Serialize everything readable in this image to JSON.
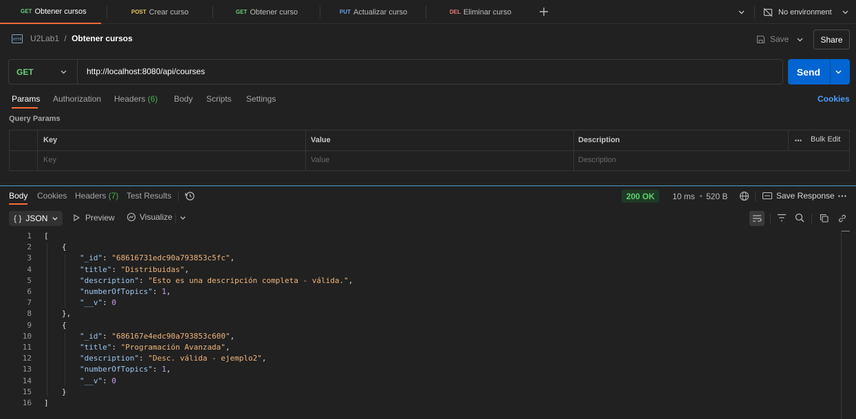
{
  "tabs": [
    {
      "method": "GET",
      "method_color": "#6ccf7a",
      "label": "Obtener cursos",
      "active": true,
      "dirty": false
    },
    {
      "method": "POST",
      "method_color": "#e8c55a",
      "label": "Crear curso",
      "active": false,
      "dirty": true
    },
    {
      "method": "GET",
      "method_color": "#6ccf7a",
      "label": "Obtener curso",
      "active": false,
      "dirty": false
    },
    {
      "method": "PUT",
      "method_color": "#6aa2f0",
      "label": "Actualizar curso",
      "active": false,
      "dirty": false
    },
    {
      "method": "DEL",
      "method_color": "#f07878",
      "label": "Eliminar curso",
      "active": false,
      "dirty": true
    }
  ],
  "environment": {
    "label": "No environment"
  },
  "header": {
    "breadcrumb_parent": "U2Lab1",
    "breadcrumb_sep": "/",
    "request_name": "Obtener cursos",
    "save_label": "Save",
    "share_label": "Share",
    "http_icon_text": "HTTP"
  },
  "request": {
    "method": "GET",
    "url": "http://localhost:8080/api/courses",
    "send_label": "Send"
  },
  "request_tabs": {
    "params": "Params",
    "authorization": "Authorization",
    "headers": "Headers",
    "headers_count": "(6)",
    "body": "Body",
    "scripts": "Scripts",
    "settings": "Settings",
    "cookies": "Cookies"
  },
  "query_params": {
    "title": "Query Params",
    "col_key": "Key",
    "col_value": "Value",
    "col_description": "Description",
    "bulk_edit": "Bulk Edit",
    "ph_key": "Key",
    "ph_value": "Value",
    "ph_description": "Description"
  },
  "response_tabs": {
    "body": "Body",
    "cookies": "Cookies",
    "headers": "Headers",
    "headers_count": "(7)",
    "test_results": "Test Results"
  },
  "response_meta": {
    "status": "200 OK",
    "time": "10 ms",
    "size": "520 B",
    "save_response": "Save Response"
  },
  "body_toolbar": {
    "format": "JSON",
    "format_prefix": "{ }",
    "preview": "Preview",
    "visualize": "Visualize"
  },
  "response_body": {
    "lines": [
      {
        "n": "1",
        "indent": 0,
        "parts": [
          {
            "t": "[",
            "c": "p"
          }
        ]
      },
      {
        "n": "2",
        "indent": 1,
        "parts": [
          {
            "t": "{",
            "c": "p"
          }
        ]
      },
      {
        "n": "3",
        "indent": 2,
        "parts": [
          {
            "t": "\"_id\"",
            "c": "k"
          },
          {
            "t": ": ",
            "c": "p"
          },
          {
            "t": "\"68616731edc90a793853c5fc\"",
            "c": "s"
          },
          {
            "t": ",",
            "c": "p"
          }
        ]
      },
      {
        "n": "4",
        "indent": 2,
        "parts": [
          {
            "t": "\"title\"",
            "c": "k"
          },
          {
            "t": ": ",
            "c": "p"
          },
          {
            "t": "\"Distribuidas\"",
            "c": "s"
          },
          {
            "t": ",",
            "c": "p"
          }
        ]
      },
      {
        "n": "5",
        "indent": 2,
        "parts": [
          {
            "t": "\"description\"",
            "c": "k"
          },
          {
            "t": ": ",
            "c": "p"
          },
          {
            "t": "\"Esto es una descripción completa - válida.\"",
            "c": "s"
          },
          {
            "t": ",",
            "c": "p"
          }
        ]
      },
      {
        "n": "6",
        "indent": 2,
        "parts": [
          {
            "t": "\"numberOfTopics\"",
            "c": "k"
          },
          {
            "t": ": ",
            "c": "p"
          },
          {
            "t": "1",
            "c": "n"
          },
          {
            "t": ",",
            "c": "p"
          }
        ]
      },
      {
        "n": "7",
        "indent": 2,
        "parts": [
          {
            "t": "\"__v\"",
            "c": "k"
          },
          {
            "t": ": ",
            "c": "p"
          },
          {
            "t": "0",
            "c": "n"
          }
        ]
      },
      {
        "n": "8",
        "indent": 1,
        "parts": [
          {
            "t": "},",
            "c": "p"
          }
        ]
      },
      {
        "n": "9",
        "indent": 1,
        "parts": [
          {
            "t": "{",
            "c": "p"
          }
        ]
      },
      {
        "n": "10",
        "indent": 2,
        "parts": [
          {
            "t": "\"_id\"",
            "c": "k"
          },
          {
            "t": ": ",
            "c": "p"
          },
          {
            "t": "\"686167e4edc90a793853c600\"",
            "c": "s"
          },
          {
            "t": ",",
            "c": "p"
          }
        ]
      },
      {
        "n": "11",
        "indent": 2,
        "parts": [
          {
            "t": "\"title\"",
            "c": "k"
          },
          {
            "t": ": ",
            "c": "p"
          },
          {
            "t": "\"Programación Avanzada\"",
            "c": "s"
          },
          {
            "t": ",",
            "c": "p"
          }
        ]
      },
      {
        "n": "12",
        "indent": 2,
        "parts": [
          {
            "t": "\"description\"",
            "c": "k"
          },
          {
            "t": ": ",
            "c": "p"
          },
          {
            "t": "\"Desc. válida - ejemplo2\"",
            "c": "s"
          },
          {
            "t": ",",
            "c": "p"
          }
        ]
      },
      {
        "n": "13",
        "indent": 2,
        "parts": [
          {
            "t": "\"numberOfTopics\"",
            "c": "k"
          },
          {
            "t": ": ",
            "c": "p"
          },
          {
            "t": "1",
            "c": "n"
          },
          {
            "t": ",",
            "c": "p"
          }
        ]
      },
      {
        "n": "14",
        "indent": 2,
        "parts": [
          {
            "t": "\"__v\"",
            "c": "k"
          },
          {
            "t": ": ",
            "c": "p"
          },
          {
            "t": "0",
            "c": "n"
          }
        ]
      },
      {
        "n": "15",
        "indent": 1,
        "parts": [
          {
            "t": "}",
            "c": "p"
          }
        ]
      },
      {
        "n": "16",
        "indent": 0,
        "parts": [
          {
            "t": "]",
            "c": "p"
          }
        ]
      }
    ]
  },
  "colors": {
    "accent": "#ff6c37",
    "send": "#0265d2",
    "status_ok": "#4caf50",
    "link": "#4a9eff"
  },
  "icons": [
    "http-icon",
    "save-icon",
    "chevron-down-icon",
    "add-tab-icon",
    "no-environment-icon",
    "history-icon",
    "globe-icon",
    "save-response-icon",
    "more-icon",
    "play-icon",
    "visualize-icon",
    "wrap-icon",
    "filter-icon",
    "search-icon",
    "copy-icon",
    "link-icon"
  ]
}
